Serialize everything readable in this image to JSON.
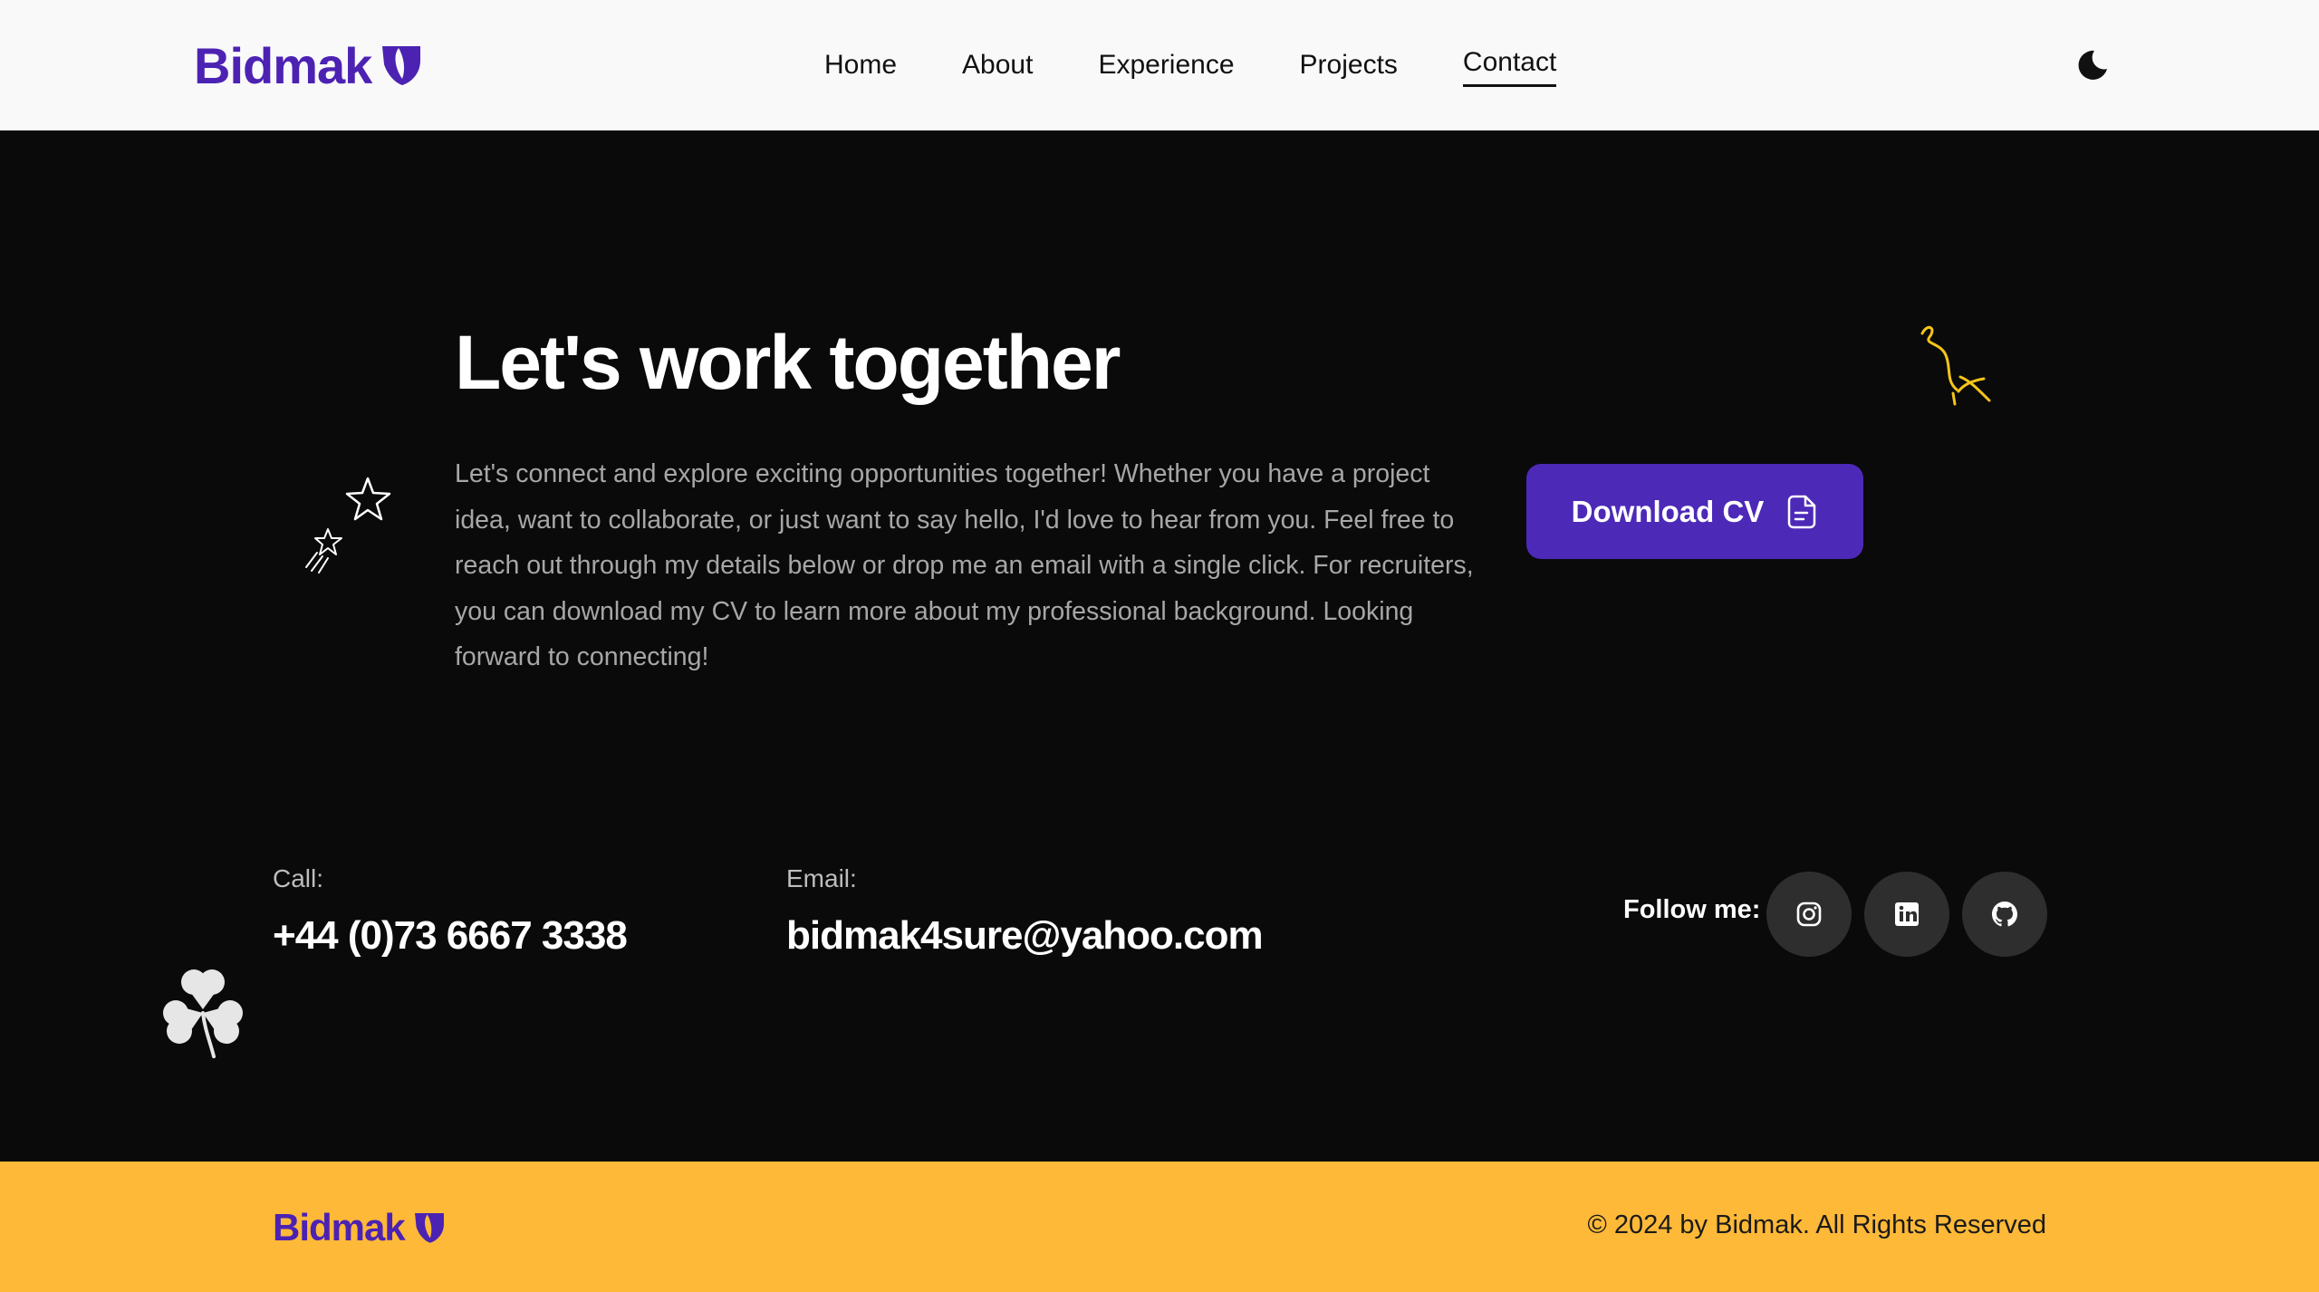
{
  "brand": {
    "name": "Bidmak",
    "color": "#4c22b3",
    "logo_icon": "typo3-shield-icon"
  },
  "nav": {
    "items": [
      {
        "label": "Home"
      },
      {
        "label": "About"
      },
      {
        "label": "Experience"
      },
      {
        "label": "Projects"
      },
      {
        "label": "Contact",
        "active": true
      }
    ],
    "theme_icon": "moon-icon"
  },
  "hero": {
    "title": "Let's work together",
    "description": "Let's connect and explore exciting opportunities together! Whether you have a project idea, want to collaborate, or just want to say hello, I'd love to hear from you. Feel free to reach out through my details below or drop me an email with a single click. For recruiters, you can download my CV to learn more about my professional background. Looking forward to connecting!",
    "cta_label": "Download CV",
    "cta_icon": "document-icon",
    "cta_color": "#4d29b8"
  },
  "contact": {
    "call_label": "Call:",
    "call_value": "+44 (0)73 6667 3338",
    "email_label": "Email:",
    "email_value": "bidmak4sure@yahoo.com",
    "follow_label": "Follow me:",
    "socials": [
      "instagram-icon",
      "linkedin-icon",
      "github-icon"
    ]
  },
  "footer": {
    "brand": "Bidmak",
    "copyright": "© 2024 by Bidmak. All Rights Reserved",
    "background": "#ffb938"
  },
  "colors": {
    "page_bg": "#0a0a0a",
    "nav_bg": "#f9f9f9",
    "accent_doodle": "#f5c518"
  }
}
